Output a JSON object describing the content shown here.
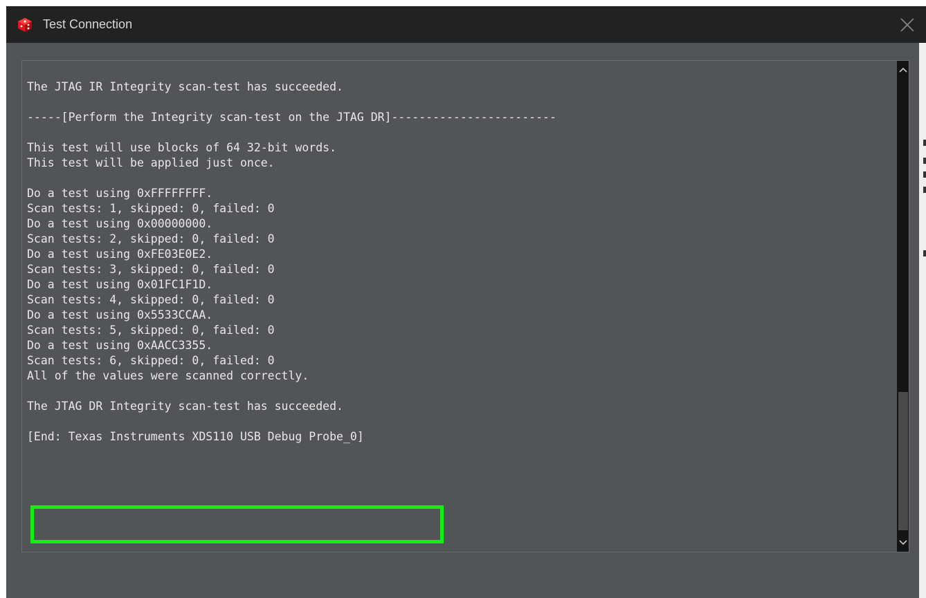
{
  "window": {
    "title": "Test Connection",
    "close_symbol": "✕",
    "app_icon": "ti-cube-icon",
    "accent_color": "#e0141e"
  },
  "console": {
    "lines": [
      "The JTAG IR Integrity scan-test has succeeded.",
      "",
      "-----[Perform the Integrity scan-test on the JTAG DR]------------------------",
      "",
      "This test will use blocks of 64 32-bit words.",
      "This test will be applied just once.",
      "",
      "Do a test using 0xFFFFFFFF.",
      "Scan tests: 1, skipped: 0, failed: 0",
      "Do a test using 0x00000000.",
      "Scan tests: 2, skipped: 0, failed: 0",
      "Do a test using 0xFE03E0E2.",
      "Scan tests: 3, skipped: 0, failed: 0",
      "Do a test using 0x01FC1F1D.",
      "Scan tests: 4, skipped: 0, failed: 0",
      "Do a test using 0x5533CCAA.",
      "Scan tests: 5, skipped: 0, failed: 0",
      "Do a test using 0xAACC3355.",
      "Scan tests: 6, skipped: 0, failed: 0",
      "All of the values were scanned correctly.",
      "",
      "The JTAG DR Integrity scan-test has succeeded.",
      "",
      "[End: Texas Instruments XDS110 USB Debug Probe_0]"
    ],
    "highlight_color": "#14f014"
  },
  "scrollbar": {
    "up_icon": "chevron-up-icon",
    "down_icon": "chevron-down-icon"
  }
}
